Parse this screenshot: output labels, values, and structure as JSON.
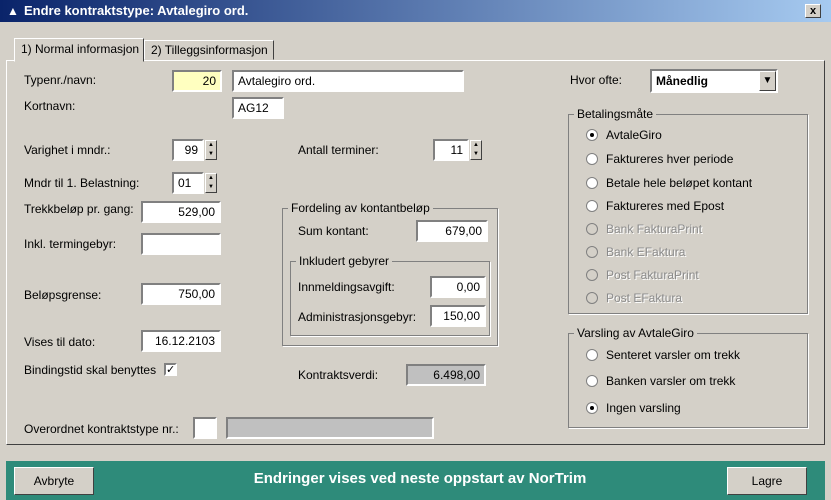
{
  "window": {
    "title": "Endre kontraktstype: Avtalegiro ord.",
    "close_label": "x"
  },
  "tabs": [
    {
      "label": "1) Normal informasjon"
    },
    {
      "label": "2) Tilleggsinformasjon"
    }
  ],
  "form": {
    "typenr_label": "Typenr./navn:",
    "typenr_value": "20",
    "navn_value": "Avtalegiro ord.",
    "kortnavn_label": "Kortnavn:",
    "kortnavn_value": "AG12",
    "varighet_label": "Varighet i mndr.:",
    "varighet_value": "99",
    "antall_terminer_label": "Antall terminer:",
    "antall_terminer_value": "11",
    "mndr_label": "Mndr til 1. Belastning:",
    "mndr_value": "01",
    "trekk_label": "Trekkbeløp pr. gang:",
    "trekk_value": "529,00",
    "inkl_label": "Inkl. termingebyr:",
    "inkl_value": "",
    "belop_label": "Beløpsgrense:",
    "belop_value": "750,00",
    "vises_label": "Vises til dato:",
    "vises_value": "16.12.2103",
    "binding_label": "Bindingstid skal benyttes",
    "binding_checked": "✓",
    "kontraktsverdi_label": "Kontraktsverdi:",
    "kontraktsverdi_value": "6.498,00",
    "overordnet_label": "Overordnet kontraktstype nr.:",
    "overordnet_value": "",
    "overordnet_name": ""
  },
  "fordeling": {
    "title": "Fordeling av kontantbeløp",
    "sum_label": "Sum kontant:",
    "sum_value": "679,00",
    "gebyr_title": "Inkludert gebyrer",
    "innmelding_label": "Innmeldingsavgift:",
    "innmelding_value": "0,00",
    "admin_label": "Administrasjonsgebyr:",
    "admin_value": "150,00"
  },
  "hvor_ofte": {
    "label": "Hvor ofte:",
    "value": "Månedlig"
  },
  "betaling": {
    "title": "Betalingsmåte",
    "options": [
      {
        "label": "AvtaleGiro"
      },
      {
        "label": "Faktureres hver periode"
      },
      {
        "label": "Betale hele beløpet kontant"
      },
      {
        "label": "Faktureres med Epost"
      },
      {
        "label": "Bank FakturaPrint"
      },
      {
        "label": "Bank EFaktura"
      },
      {
        "label": "Post FakturaPrint"
      },
      {
        "label": "Post EFaktura"
      }
    ]
  },
  "varsling": {
    "title": "Varsling av AvtaleGiro",
    "options": [
      {
        "label": "Senteret varsler om trekk"
      },
      {
        "label": "Banken varsler om trekk"
      },
      {
        "label": "Ingen varsling"
      }
    ]
  },
  "footer": {
    "cancel_label": "Avbryte",
    "message": "Endringer vises ved neste oppstart av NorTrim",
    "save_label": "Lagre"
  },
  "colors": {
    "title_bar": "#0a246a",
    "status_bar": "#2e8b7a",
    "highlight_field": "#ffffc0"
  }
}
